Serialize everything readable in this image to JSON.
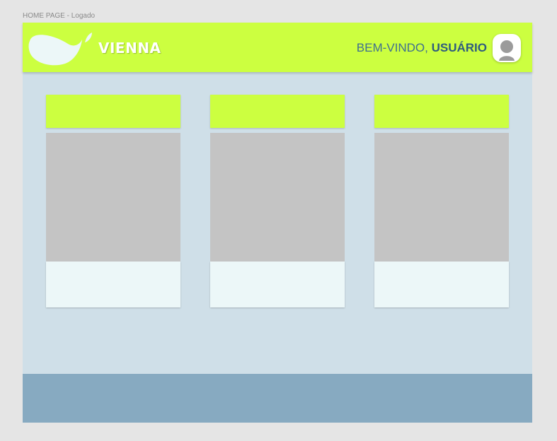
{
  "frame": {
    "label": "HOME PAGE - Logado"
  },
  "header": {
    "brand": "VIENNA",
    "logo_icon": "leaf-logo-icon",
    "welcome_prefix": "BEM-VINDO, ",
    "username": "USUÁRIO",
    "avatar_icon": "user-avatar-icon"
  },
  "cards": [
    {
      "name": "card-1"
    },
    {
      "name": "card-2"
    },
    {
      "name": "card-3"
    }
  ],
  "colors": {
    "accent": "#ccff40",
    "background": "#cfdfe8",
    "image_placeholder": "#c4c4c4",
    "card_body": "#ecf7f8",
    "footer": "#87aac1",
    "text": "#3f6f8f"
  }
}
